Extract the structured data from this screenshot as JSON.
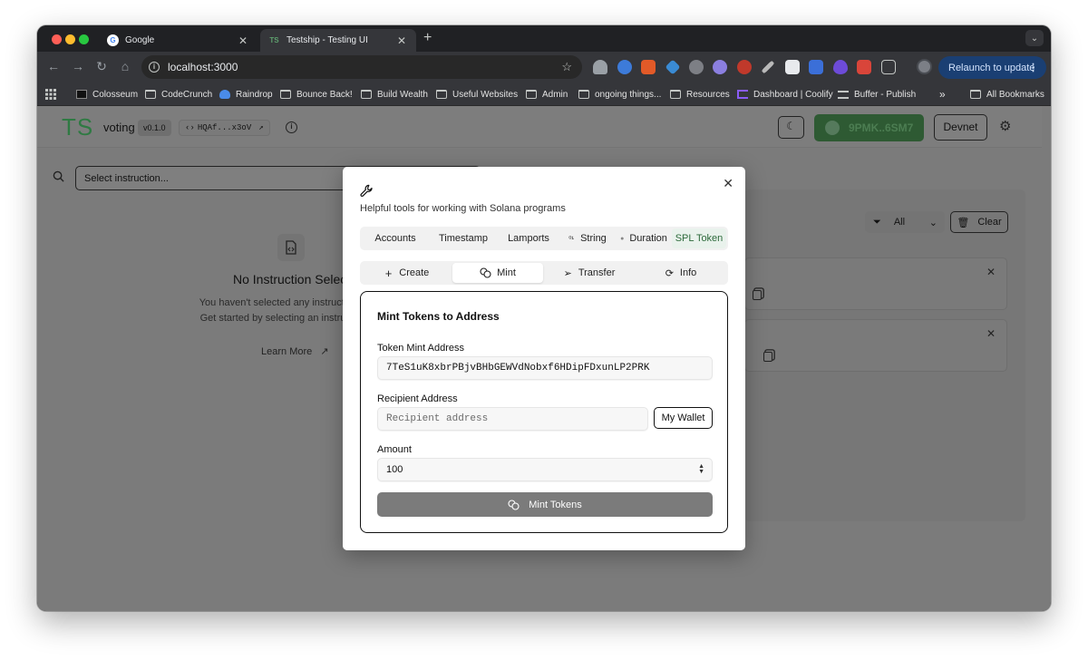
{
  "browser": {
    "tabs": [
      {
        "title": "Google",
        "active": false,
        "favicon": "google-icon"
      },
      {
        "title": "Testship - Testing UI",
        "active": true,
        "favicon": "ts-icon",
        "favicon_text": "TS"
      }
    ],
    "url": "localhost:3000",
    "relaunch_label": "Relaunch to update",
    "bookmarks": [
      {
        "label": "Colosseum",
        "icon": "colosseum-icon"
      },
      {
        "label": "CodeCrunch",
        "icon": "folder-icon"
      },
      {
        "label": "Raindrop",
        "icon": "raindrop-icon"
      },
      {
        "label": "Bounce Back!",
        "icon": "folder-icon"
      },
      {
        "label": "Build Wealth",
        "icon": "folder-icon"
      },
      {
        "label": "Useful Websites",
        "icon": "folder-icon"
      },
      {
        "label": "Admin",
        "icon": "folder-icon"
      },
      {
        "label": "ongoing things...",
        "icon": "folder-icon"
      },
      {
        "label": "Resources",
        "icon": "folder-icon"
      },
      {
        "label": "Dashboard | Coolify",
        "icon": "coolify-icon"
      },
      {
        "label": "Buffer - Publish",
        "icon": "buffer-icon"
      }
    ],
    "bookmarks_overflow": "»",
    "all_bookmarks_label": "All Bookmarks"
  },
  "app": {
    "logo": "TS",
    "program_name": "voting",
    "version": "v0.1.0",
    "program_id": "HQAf...x3oV",
    "wallet": "9PMK..6SM7",
    "network": "Devnet",
    "select_placeholder": "Select instruction...",
    "empty_title": "No Instruction Selecte",
    "empty_line1": "You haven't selected any instructi",
    "empty_line2": "Get started by selecting an instru",
    "learn_more": "Learn More",
    "filter_value": "All",
    "clear_label": "Clear"
  },
  "modal": {
    "subtitle": "Helpful tools for working with Solana programs",
    "tool_tabs": [
      {
        "label": "Accounts"
      },
      {
        "label": "Timestamp"
      },
      {
        "label": "Lamports"
      },
      {
        "label": "String",
        "icon": "binary-icon"
      },
      {
        "label": "Duration",
        "icon": "dot-icon"
      },
      {
        "label": "SPL Token",
        "active": true
      }
    ],
    "action_tabs": [
      {
        "label": "Create",
        "icon": "plus-icon"
      },
      {
        "label": "Mint",
        "icon": "coins-icon",
        "active": true
      },
      {
        "label": "Transfer",
        "icon": "send-icon"
      },
      {
        "label": "Info",
        "icon": "refresh-icon"
      }
    ],
    "form": {
      "title": "Mint Tokens to Address",
      "mint_label": "Token Mint Address",
      "mint_value": "7TeS1uK8xbrPBjvBHbGEWVdNobxf6HDipFDxunLP2PRK",
      "recipient_label": "Recipient Address",
      "recipient_placeholder": "Recipient address",
      "my_wallet_label": "My Wallet",
      "amount_label": "Amount",
      "amount_value": "100",
      "submit_label": "Mint Tokens"
    }
  },
  "colors": {
    "accent_green": "#2f7a43",
    "relaunch_bg": "#1a3f73",
    "overlay_gray": "#7b7b7b"
  }
}
